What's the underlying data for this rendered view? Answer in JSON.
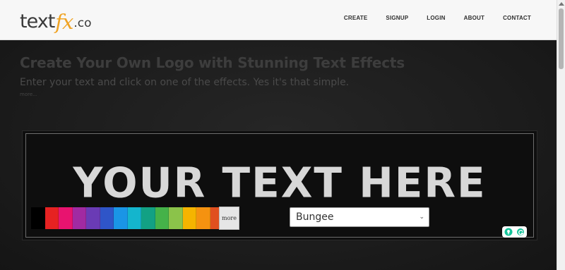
{
  "logo": {
    "part1": "text",
    "part2": "fx",
    "part3": ".co"
  },
  "nav": [
    "CREATE",
    "SIGNUP",
    "LOGIN",
    "ABOUT",
    "CONTACT"
  ],
  "hero": {
    "headline": "Create Your Own Logo with Stunning Text Effects",
    "subline": "Enter your text and click on one of the effects. Yes it's that simple.",
    "more_link": "more..."
  },
  "preview": {
    "text": "YOUR TEXT HERE"
  },
  "colors": {
    "swatches": [
      "#000000",
      "#e62222",
      "#e8136f",
      "#a12aa2",
      "#6a3bb5",
      "#2f55c8",
      "#1a95e6",
      "#14b5cd",
      "#12a184",
      "#45b249",
      "#8bc34a",
      "#f5b400",
      "#f59210",
      "#e0501f"
    ],
    "selected": "#ffffff"
  },
  "controls": {
    "more_button": "more",
    "font_select_value": "Bungee"
  },
  "icons": {
    "check": "check-icon",
    "bulb": "lightbulb-icon",
    "grammarly": "grammarly-icon",
    "caret": "chevron-down-icon"
  }
}
